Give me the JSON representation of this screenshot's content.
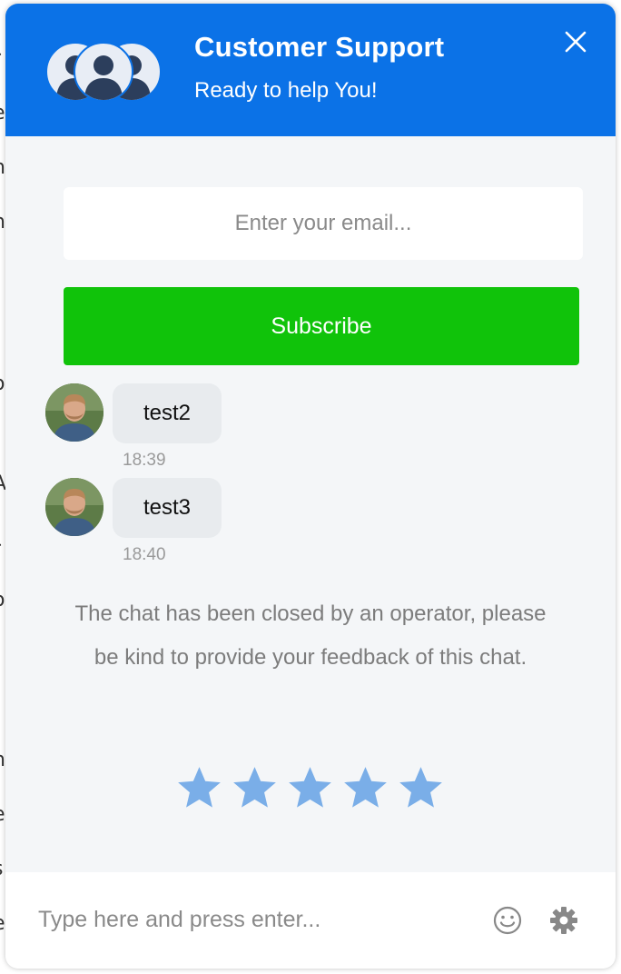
{
  "background": {
    "edge_letters": [
      "r",
      "e",
      "n",
      "n,",
      "o",
      "l",
      "A",
      "r",
      "o",
      "n",
      "e",
      "s",
      "e"
    ]
  },
  "header": {
    "title": "Customer Support",
    "subtitle": "Ready to help You!",
    "avatar_icon": "user-group-icon",
    "close_icon": "close-icon",
    "color": "#0b72e7"
  },
  "subscribe": {
    "email_placeholder": "Enter your email...",
    "email_value": "",
    "button_label": "Subscribe",
    "button_color": "#10c30a"
  },
  "messages": [
    {
      "text": "test2",
      "time": "18:39",
      "avatar_icon": "operator-avatar"
    },
    {
      "text": "test3",
      "time": "18:40",
      "avatar_icon": "operator-avatar"
    }
  ],
  "closed_notice": "The chat has been closed by an operator, please be kind to provide your feedback of this chat.",
  "rating": {
    "max": 5,
    "value": 0,
    "star_color": "#7aaee8"
  },
  "composer": {
    "placeholder": "Type here and press enter...",
    "value": "",
    "emoji_icon": "smiley-icon",
    "settings_icon": "gear-icon"
  }
}
